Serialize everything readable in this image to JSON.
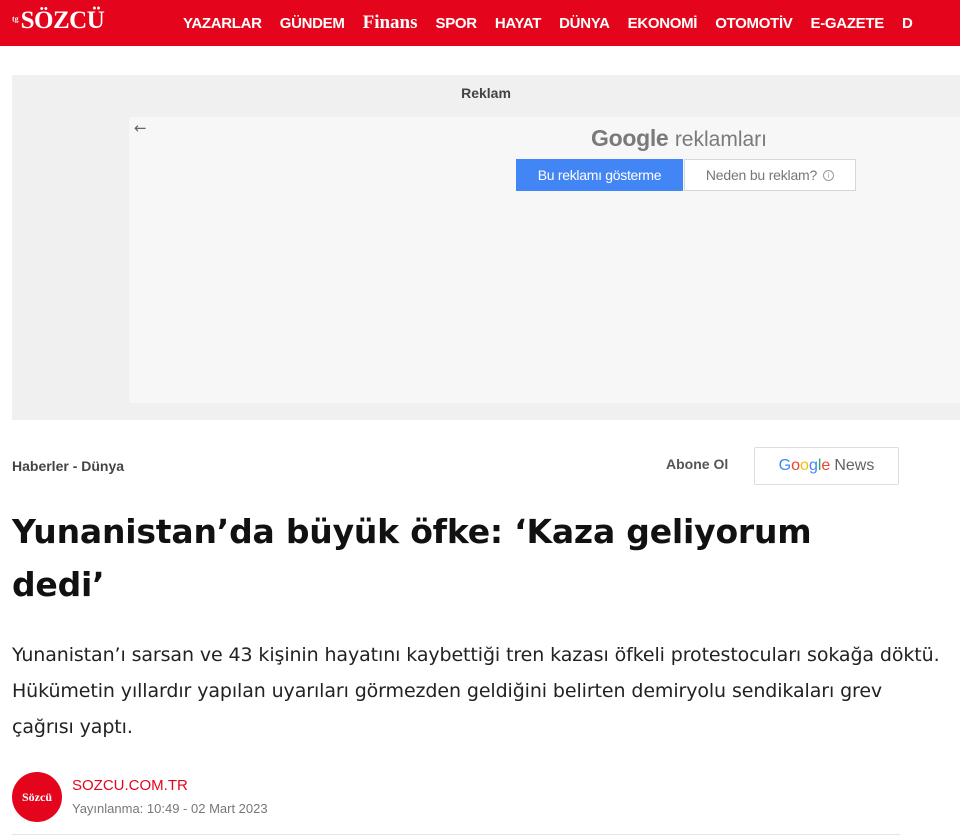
{
  "header": {
    "logo_text": "SÖZCÜ",
    "nav": [
      "YAZARLAR",
      "GÜNDEM",
      "Finans",
      "SPOR",
      "HAYAT",
      "DÜNYA",
      "EKONOMİ",
      "OTOMOTİV",
      "E-GAZETE",
      "D"
    ],
    "brand_color": "#e4051d"
  },
  "ad": {
    "label": "Reklam",
    "google_word": "Google",
    "google_suffix": "reklamları",
    "hide_button": "Bu reklamı gösterme",
    "why_button": "Neden bu reklam?",
    "info_icon": "i"
  },
  "breadcrumb": {
    "text": "Haberler - Dünya"
  },
  "subscribe": {
    "label": "Abone Ol",
    "google": [
      "G",
      "o",
      "o",
      "g",
      "l",
      "e"
    ],
    "news": "News"
  },
  "article": {
    "headline": "Yunanistan’da büyük öfke: ‘Kaza geliyorum dedi’",
    "summary": "Yunanistan’ı sarsan ve 43 kişinin hayatını kaybettiği tren kazası öfkeli protestocuları sokağa döktü. Hükümetin yıllardır yapılan uyarıları görmezden geldiğini belirten demiryolu sendikaları grev çağrısı yaptı."
  },
  "author": {
    "avatar_text": "Sözcü",
    "source": "SOZCU.COM.TR",
    "published": "Yayınlanma: 10:49 - 02 Mart 2023"
  }
}
